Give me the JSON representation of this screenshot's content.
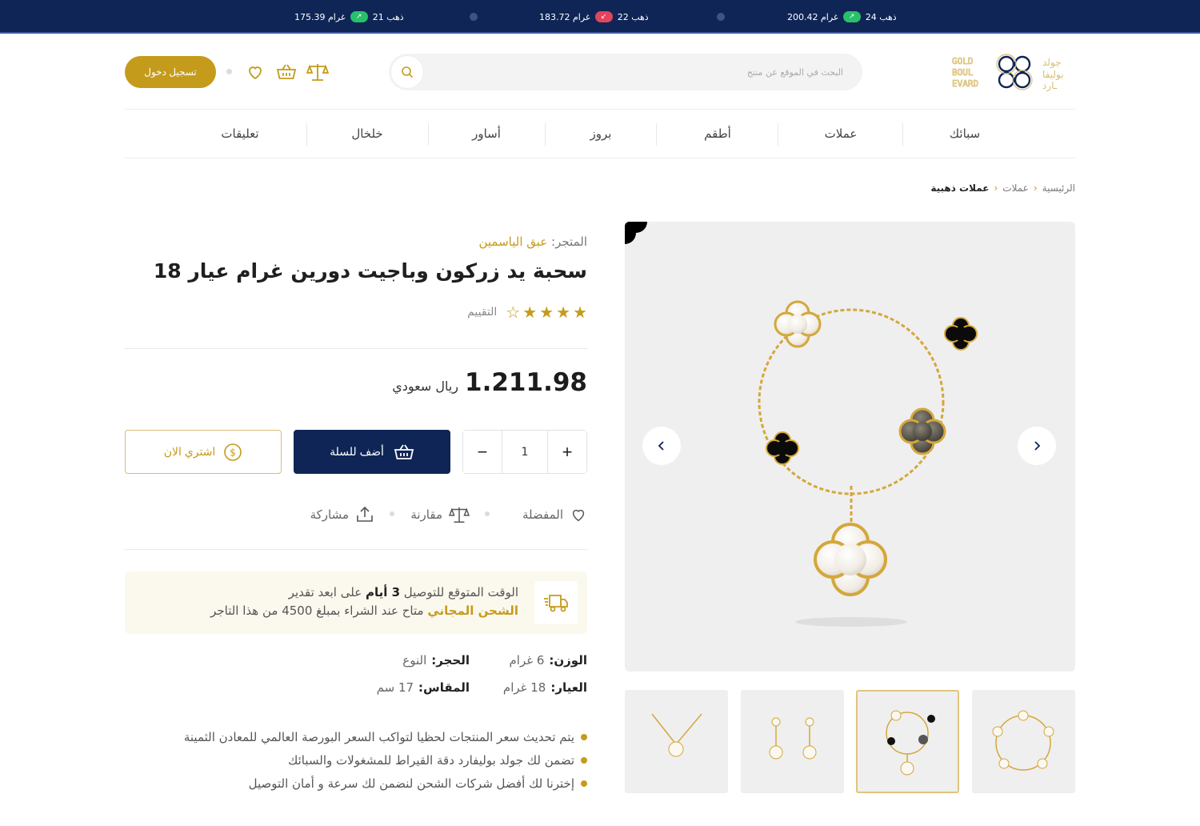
{
  "ticker": [
    {
      "label": "ذهب 24",
      "price": "200.42 غرام",
      "trend": "up"
    },
    {
      "label": "ذهب 22",
      "price": "183.72 غرام",
      "trend": "down"
    },
    {
      "label": "ذهب 21",
      "price": "175.39 غرام",
      "trend": "up"
    }
  ],
  "header": {
    "login_label": "تسجيل دخول",
    "search_placeholder": "البحث في الموقع عن منتج",
    "logo_text_en": "GOLD BOULEVARD",
    "logo_text_ar": "جولد بوليفارد"
  },
  "nav": [
    "سبائك",
    "عملات",
    "أطقم",
    "بروز",
    "أساور",
    "خلخال",
    "تعليقات"
  ],
  "breadcrumb": {
    "home": "الرئيسية",
    "parent": "عملات",
    "current": "عملات ذهبية"
  },
  "product": {
    "store_label": "المتجر:",
    "store_name": "عبق الياسمين",
    "title": "سحبة يد زركون وباجيت دورين غرام عيار 18",
    "rating_label": "التقييم",
    "rating": 4,
    "rating_max": 5,
    "price": "1.211.98",
    "currency": "ريال سعودي",
    "quantity": "1",
    "add_to_cart": "أضف للسلة",
    "buy_now": "اشتري الان",
    "actions": {
      "favorite": "المفضلة",
      "compare": "مقارنة",
      "share": "مشاركة"
    }
  },
  "delivery": {
    "line1_pre": "الوقت المتوقع للتوصيل",
    "line1_bold": "3 أيام",
    "line1_post": "على ابعد تقدير",
    "line2_gold": "الشحن المجاني",
    "line2_post": "متاح عند الشراء بمبلغ 4500 من هذا التاجر"
  },
  "specs": {
    "weight_key": "الوزن:",
    "weight_val": "6 غرام",
    "stone_key": "الحجر:",
    "stone_val": "النوع",
    "karat_key": "العيار:",
    "karat_val": "18 غرام",
    "size_key": "المقاس:",
    "size_val": "17 سم"
  },
  "features": [
    "يتم تحديث سعر المنتجات لحظيا لتواكب السعر البورصة العالمي للمعادن الثمينة",
    "تضمن لك جولد بوليفارد دقة القيراط للمشغولات والسبائك",
    "إخترنا لك أفضل شركات الشحن لنضمن لك سرعة و أمان التوصيل"
  ],
  "colors": {
    "navy": "#0f2556",
    "gold": "#c59b1c",
    "up": "#28c06b",
    "down": "#e2445c"
  }
}
